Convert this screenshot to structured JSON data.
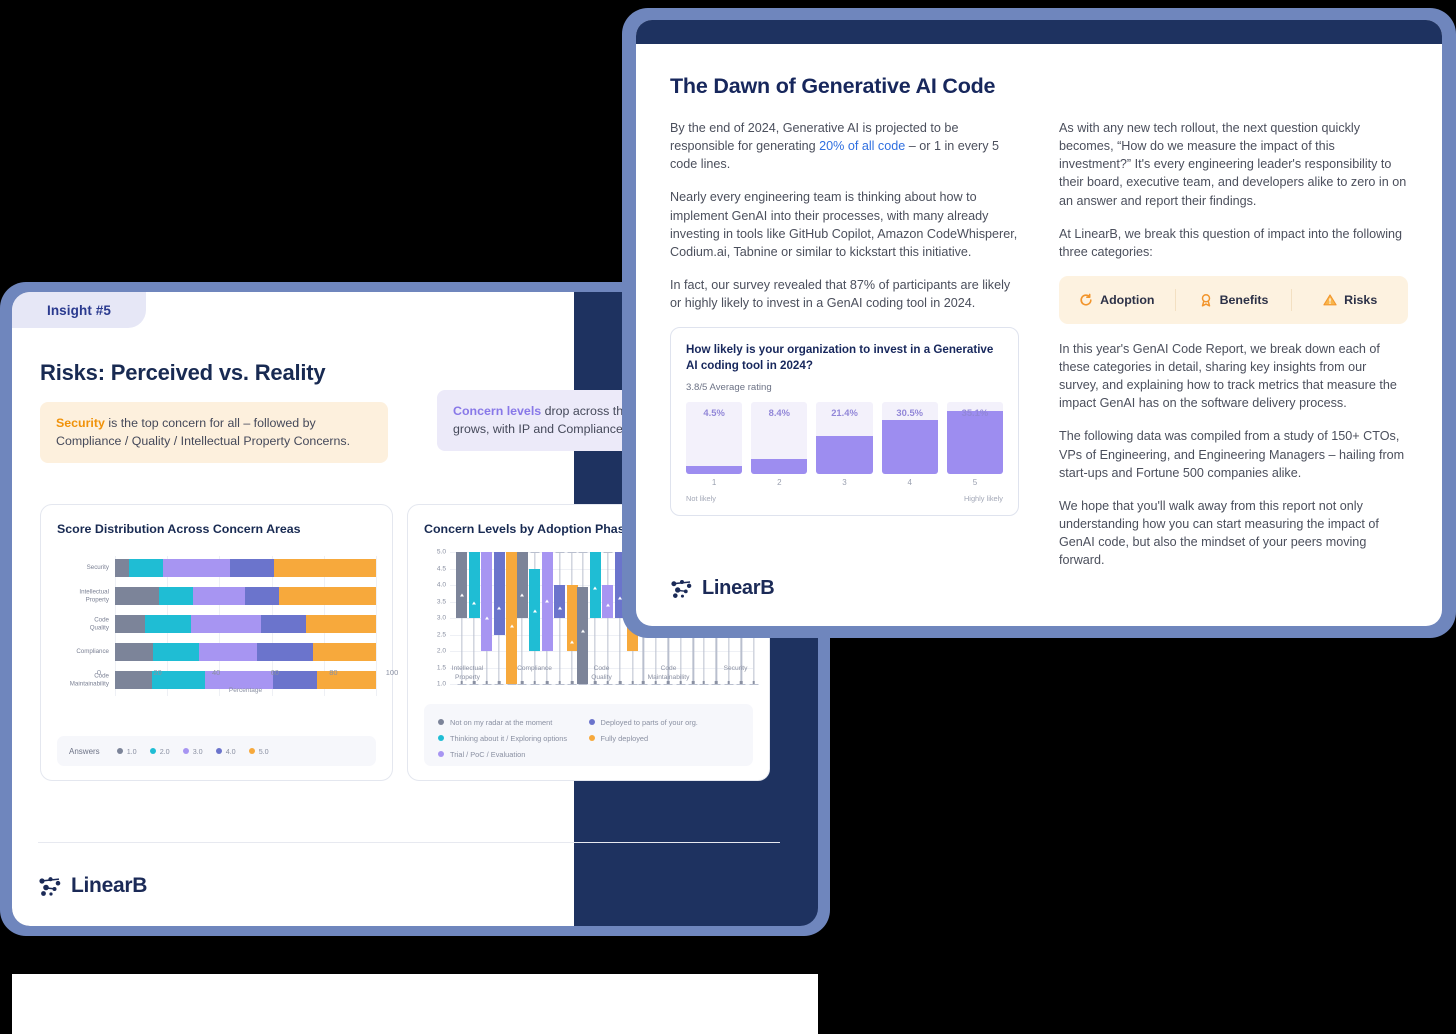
{
  "left_card": {
    "badge": "Insight #5",
    "title": "Risks: Perceived vs. Reality",
    "callout_1": {
      "highlight": "Security",
      "text": " is the top concern for all – followed by Compliance / Quality / Intellectual Property Concerns."
    },
    "callout_2": {
      "highlight": "Concern levels",
      "text": " drop across the board as adoption grows, with IP and Compliance taking the lead."
    },
    "logo_text": "LinearB"
  },
  "right_card": {
    "title": "The Dawn of Generative AI Code",
    "logo_text": "LinearB",
    "left_column": {
      "p1_a": "By the end of 2024, Generative AI is projected to be responsible for generating ",
      "p1_link": "20% of all code",
      "p1_b": " – or 1 in every 5 code lines.",
      "p2": "Nearly every engineering team is thinking about how to implement GenAI into their processes, with many already investing in tools like GitHub Copilot, Amazon CodeWhisperer, Codium.ai, Tabnine or similar to kickstart this initiative.",
      "p3": "In fact, our survey revealed that 87% of participants are likely or highly likely to invest in a GenAI coding tool in 2024."
    },
    "right_column": {
      "p1": "As with any new tech rollout, the next question quickly becomes, “How do we measure the impact of this investment?” It's every engineering leader's responsibility to their board, executive team, and developers alike to zero in on an answer and report their findings.",
      "p2": "At LinearB, we break this question of impact into the following three categories:",
      "p3": "In this year's GenAI Code Report, we break down each of these categories in detail, sharing key insights from our survey, and explaining how to track metrics that measure the impact GenAI has on the software delivery process.",
      "p4": "The following data was compiled from a study of 150+ CTOs, VPs of Engineering, and Engineering Managers – hailing from start-ups and Fortune 500 companies alike.",
      "p5": "We hope that you'll walk away from this report not only understanding how you can start measuring the impact of GenAI code, but also the mindset of your peers moving forward."
    },
    "pills": [
      {
        "icon": "refresh-icon",
        "label": "Adoption"
      },
      {
        "icon": "award-icon",
        "label": "Benefits"
      },
      {
        "icon": "warning-triangle-icon",
        "label": "Risks"
      }
    ]
  },
  "colors": {
    "navy": "#1e3260",
    "frame_blue": "#6f86bd",
    "purple": "#9d8df0",
    "purple_track": "#f3f1fb",
    "orange": "#f7a93c",
    "gray": "#7c8499",
    "teal": "#1fbdd4",
    "lavender": "#a795f2",
    "indigo": "#6b74cc",
    "link_blue": "#2f6fe0",
    "amber_text": "#f0920a"
  },
  "chart_data": [
    {
      "type": "bar",
      "subtype": "stacked-horizontal-100",
      "title": "Score Distribution Across Concern Areas",
      "xlabel": "Percentage",
      "ylabel": "",
      "xlim": [
        0,
        100
      ],
      "xticks": [
        0,
        20,
        40,
        60,
        80,
        100
      ],
      "grid": true,
      "legend_title": "Answers",
      "legend_position": "bottom",
      "categories": [
        "Security",
        "Intellectual Property",
        "Code Quality",
        "Compliance",
        "Code Maintainability"
      ],
      "series": [
        {
          "name": "1.0",
          "color": "#7c8499",
          "values": [
            5.5,
            17.0,
            11.5,
            14.5,
            14.0
          ]
        },
        {
          "name": "2.0",
          "color": "#1fbdd4",
          "values": [
            13.0,
            13.0,
            17.5,
            17.5,
            20.5
          ]
        },
        {
          "name": "3.0",
          "color": "#a795f2",
          "values": [
            25.5,
            20.0,
            27.0,
            22.5,
            26.0
          ]
        },
        {
          "name": "4.0",
          "color": "#6b74cc",
          "values": [
            17.0,
            13.0,
            17.0,
            21.5,
            17.0
          ]
        },
        {
          "name": "5.0",
          "color": "#f7a93c",
          "values": [
            39.0,
            37.0,
            27.0,
            24.0,
            22.5
          ]
        }
      ]
    },
    {
      "type": "box",
      "title": "Concern Levels by Adoption Phase",
      "ylabel": "",
      "ylim": [
        1.0,
        5.0
      ],
      "yticks": [
        1.0,
        1.5,
        2.0,
        2.5,
        3.0,
        3.5,
        4.0,
        4.5,
        5.0
      ],
      "grid": true,
      "legend_position": "bottom",
      "categories": [
        "Intellectual Property",
        "Compliance",
        "Code Quality",
        "Code Maintainability",
        "Security"
      ],
      "series": [
        {
          "name": "Not on my radar at the moment",
          "color": "#7c8499"
        },
        {
          "name": "Thinking about it / Exploring options",
          "color": "#1fbdd4"
        },
        {
          "name": "Trial / PoC / Evaluation",
          "color": "#a795f2"
        },
        {
          "name": "Deployed to parts of your org.",
          "color": "#6b74cc"
        },
        {
          "name": "Fully deployed",
          "color": "#f7a93c"
        }
      ],
      "boxes": [
        [
          {
            "whisker_low": 1.0,
            "q1": 3.0,
            "q3": 5.0,
            "mean": 3.8,
            "whisker_high": 5.0
          },
          {
            "whisker_low": 1.0,
            "q1": 3.0,
            "q3": 5.0,
            "mean": 3.55,
            "whisker_high": 5.0
          },
          {
            "whisker_low": 1.0,
            "q1": 2.0,
            "q3": 5.0,
            "mean": 3.1,
            "whisker_high": 5.0
          },
          {
            "whisker_low": 1.0,
            "q1": 2.5,
            "q3": 5.0,
            "mean": 3.4,
            "whisker_high": 5.0
          },
          {
            "whisker_low": 1.0,
            "q1": 1.0,
            "q3": 5.0,
            "mean": 2.85,
            "whisker_high": 5.0
          }
        ],
        [
          {
            "whisker_low": 1.0,
            "q1": 3.0,
            "q3": 5.0,
            "mean": 3.8,
            "whisker_high": 5.0
          },
          {
            "whisker_low": 1.0,
            "q1": 2.0,
            "q3": 4.5,
            "mean": 3.3,
            "whisker_high": 5.0
          },
          {
            "whisker_low": 1.0,
            "q1": 2.0,
            "q3": 5.0,
            "mean": 3.6,
            "whisker_high": 5.0
          },
          {
            "whisker_low": 1.0,
            "q1": 3.0,
            "q3": 4.0,
            "mean": 3.4,
            "whisker_high": 5.0
          },
          {
            "whisker_low": 1.0,
            "q1": 2.0,
            "q3": 4.0,
            "mean": 2.35,
            "whisker_high": 5.0
          }
        ],
        [
          {
            "whisker_low": 1.0,
            "q1": 1.0,
            "q3": 3.95,
            "mean": 2.7,
            "whisker_high": 5.0
          },
          {
            "whisker_low": 1.0,
            "q1": 3.0,
            "q3": 5.0,
            "mean": 4.0,
            "whisker_high": 5.0
          },
          {
            "whisker_low": 1.0,
            "q1": 3.0,
            "q3": 4.0,
            "mean": 3.5,
            "whisker_high": 5.0
          },
          {
            "whisker_low": 1.0,
            "q1": 3.0,
            "q3": 5.0,
            "mean": 3.7,
            "whisker_high": 5.0
          },
          {
            "whisker_low": 1.0,
            "q1": 2.0,
            "q3": 3.9,
            "mean": 2.95,
            "whisker_high": 5.0
          }
        ],
        [
          {
            "whisker_low": 1.0,
            "q1": 2.8,
            "q3": 5.0,
            "mean": 3.5,
            "whisker_high": 5.0
          },
          {
            "whisker_low": 1.0,
            "q1": 3.0,
            "q3": 5.0,
            "mean": 3.55,
            "whisker_high": 5.0
          },
          {
            "whisker_low": 1.0,
            "q1": 3.0,
            "q3": 5.0,
            "mean": 3.5,
            "whisker_high": 5.0
          },
          {
            "whisker_low": 1.0,
            "q1": 3.0,
            "q3": 5.0,
            "mean": 3.6,
            "whisker_high": 5.0
          },
          {
            "whisker_low": 1.0,
            "q1": 2.5,
            "q3": 4.5,
            "mean": 3.1,
            "whisker_high": 5.0
          }
        ],
        [
          {
            "whisker_low": 1.0,
            "q1": 3.0,
            "q3": 5.0,
            "mean": 3.9,
            "whisker_high": 5.0
          },
          {
            "whisker_low": 1.0,
            "q1": 3.0,
            "q3": 5.0,
            "mean": 4.0,
            "whisker_high": 5.0
          },
          {
            "whisker_low": 1.0,
            "q1": 3.0,
            "q3": 5.0,
            "mean": 3.9,
            "whisker_high": 5.0
          },
          {
            "whisker_low": 1.0,
            "q1": 3.5,
            "q3": 5.0,
            "mean": 4.1,
            "whisker_high": 5.0
          },
          {
            "whisker_low": 1.0,
            "q1": 3.0,
            "q3": 5.0,
            "mean": 3.8,
            "whisker_high": 5.0
          }
        ]
      ]
    },
    {
      "type": "bar",
      "subtype": "vertical-percent",
      "title": "How likely is your organization to invest in a Generative AI coding tool in 2024?",
      "subtitle": "3.8/5 Average rating",
      "categories": [
        "1",
        "2",
        "3",
        "4",
        "5"
      ],
      "values": [
        4.5,
        8.4,
        21.4,
        30.5,
        35.1
      ],
      "value_labels": [
        "4.5%",
        "8.4%",
        "21.4%",
        "30.5%",
        "35.1%"
      ],
      "axis_low_label": "Not likely",
      "axis_high_label": "Highly likely",
      "ylim": [
        0,
        40
      ],
      "grid": false
    }
  ]
}
